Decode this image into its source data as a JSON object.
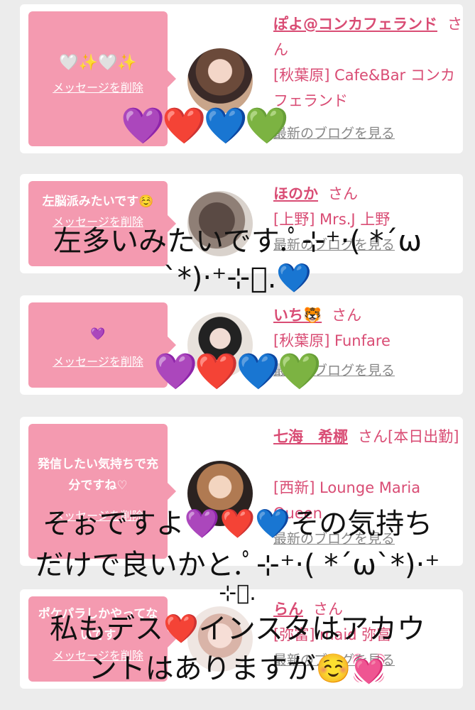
{
  "cards": [
    {
      "message": "🤍✨🤍✨",
      "delete_label": "メッセージを削除",
      "name": "ぽよ@コンカフェランド",
      "san": "さん",
      "shop": "[秋葉原] Cafe&Bar コンカフェランド",
      "blog": "最新のブログを見る"
    },
    {
      "message": "左脳派みたいです☺️",
      "delete_label": "メッセージを削除",
      "name": "ほのか",
      "san": "さん",
      "shop": "[上野] Mrs.J 上野",
      "blog": "最新のブログを見る"
    },
    {
      "message": "💜",
      "delete_label": "メッセージを削除",
      "name": "いち🐯",
      "san": "さん",
      "shop": "[秋葉原] Funfare",
      "blog": "最新のブログを見る"
    },
    {
      "message": "発信したい気持ちで充分ですね♡",
      "delete_label": "メッセージを削除",
      "name": "七海　希梛",
      "san": "さん[本日出勤]",
      "shop": "[西新] Lounge Maria Queen",
      "blog": "最新のブログを見る"
    },
    {
      "message": "ポケパラしかやってないです",
      "delete_label": "メッセージを削除",
      "name": "らん",
      "san": "さん",
      "shop": "[弥富] maid 弥富",
      "blog": "最新のブログを見る"
    }
  ],
  "overlays": {
    "hearts_1": "💜❤️💙💚",
    "line_1": "左多いみたいです.ﾟ⊹⁺‧( *´ω",
    "line_2": "`*)‧⁺⊹ﾟ.💙",
    "hearts_2": "💜❤️💙💚",
    "line_3": "そぉですよ💜❤️💙その気持ち",
    "line_4": "だけで良いかと.ﾟ⊹⁺‧( *´ω`*)‧⁺",
    "line_5": "⊹ﾟ.",
    "line_6": "私もデス❤️インスタはアカウ",
    "line_7": "ントはありますが☺️💓"
  },
  "colors": {
    "accent": "#d94c74",
    "bubble": "#f49ab0",
    "background": "#ececec"
  }
}
